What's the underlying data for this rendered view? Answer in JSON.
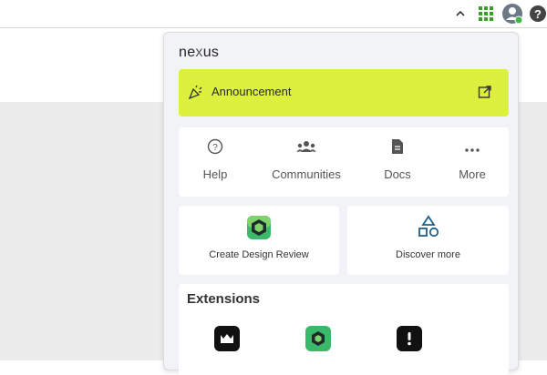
{
  "logo": {
    "prefix": "ne",
    "mark": "x",
    "suffix": "us"
  },
  "announcement": {
    "label": "Announcement"
  },
  "links": [
    {
      "label": "Help",
      "icon": "help-circle-icon"
    },
    {
      "label": "Communities",
      "icon": "people-icon"
    },
    {
      "label": "Docs",
      "icon": "document-icon"
    },
    {
      "label": "More",
      "icon": "more-dots-icon"
    }
  ],
  "cards": {
    "left": {
      "label": "Create Design Review",
      "icon": "design-review-icon"
    },
    "right": {
      "label": "Discover more",
      "icon": "shapes-icon"
    }
  },
  "extensions": {
    "title": "Extensions"
  },
  "colors": {
    "accent": "#dcf03d",
    "grid_green": "#3a9e2a",
    "panel_bg": "#f2f3f6"
  }
}
